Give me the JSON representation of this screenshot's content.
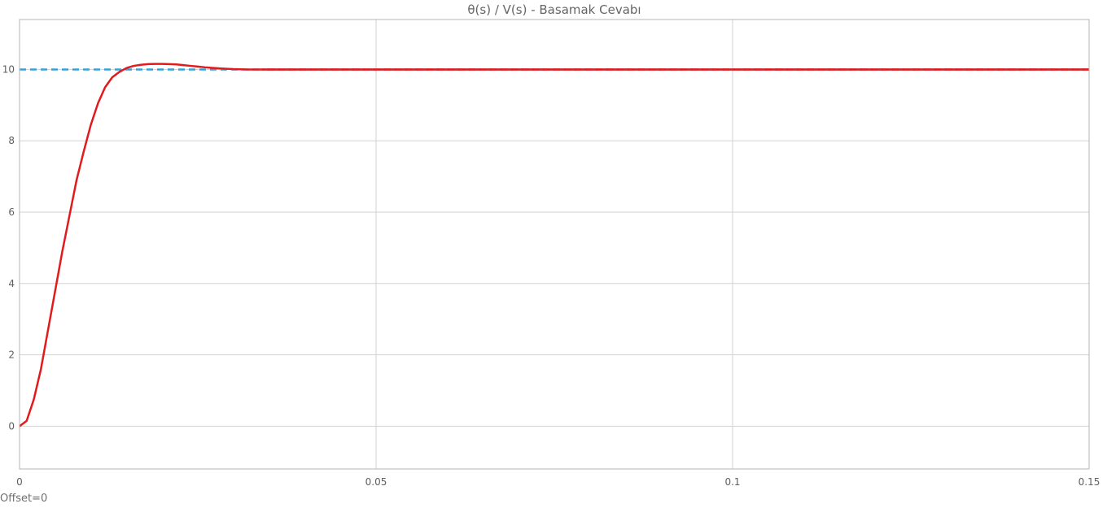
{
  "chart_data": {
    "type": "line",
    "title": "θ(s) / V(s) - Basamak Cevabı",
    "xlabel": "",
    "ylabel": "",
    "xlim": [
      0,
      0.15
    ],
    "ylim": [
      -1.2,
      11.4
    ],
    "grid": true,
    "x_ticks": [
      0,
      0.05,
      0.1,
      0.15
    ],
    "x_tick_labels": [
      "0",
      "0.05",
      "0.1",
      "0.15"
    ],
    "y_ticks": [
      0,
      2,
      4,
      6,
      8,
      10
    ],
    "y_tick_labels": [
      "0",
      "2",
      "4",
      "6",
      "8",
      "10"
    ],
    "series": [
      {
        "color": "#e31a1c",
        "style": "solid",
        "x": [
          0,
          0.001,
          0.002,
          0.003,
          0.004,
          0.005,
          0.006,
          0.007,
          0.008,
          0.009,
          0.01,
          0.011,
          0.012,
          0.013,
          0.014,
          0.015,
          0.016,
          0.017,
          0.018,
          0.019,
          0.02,
          0.021,
          0.022,
          0.023,
          0.024,
          0.025,
          0.026,
          0.027,
          0.028,
          0.029,
          0.03,
          0.032,
          0.034,
          0.036,
          0.04,
          0.05,
          0.06,
          0.08,
          0.1,
          0.12,
          0.15
        ],
        "y": [
          0,
          0.15,
          0.75,
          1.6,
          2.7,
          3.8,
          4.9,
          5.9,
          6.9,
          7.7,
          8.45,
          9.05,
          9.5,
          9.78,
          9.93,
          10.04,
          10.1,
          10.13,
          10.15,
          10.155,
          10.155,
          10.15,
          10.14,
          10.12,
          10.1,
          10.08,
          10.06,
          10.045,
          10.03,
          10.02,
          10.01,
          10.0,
          10.0,
          10.0,
          10.0,
          10.0,
          10.0,
          10.0,
          10.0,
          10.0,
          10.0
        ]
      },
      {
        "color": "#3aa0d8",
        "style": "dashed",
        "x": [
          0,
          0.15
        ],
        "y": [
          10,
          10
        ]
      }
    ]
  },
  "footer": {
    "offset_label": "Offset=0"
  }
}
